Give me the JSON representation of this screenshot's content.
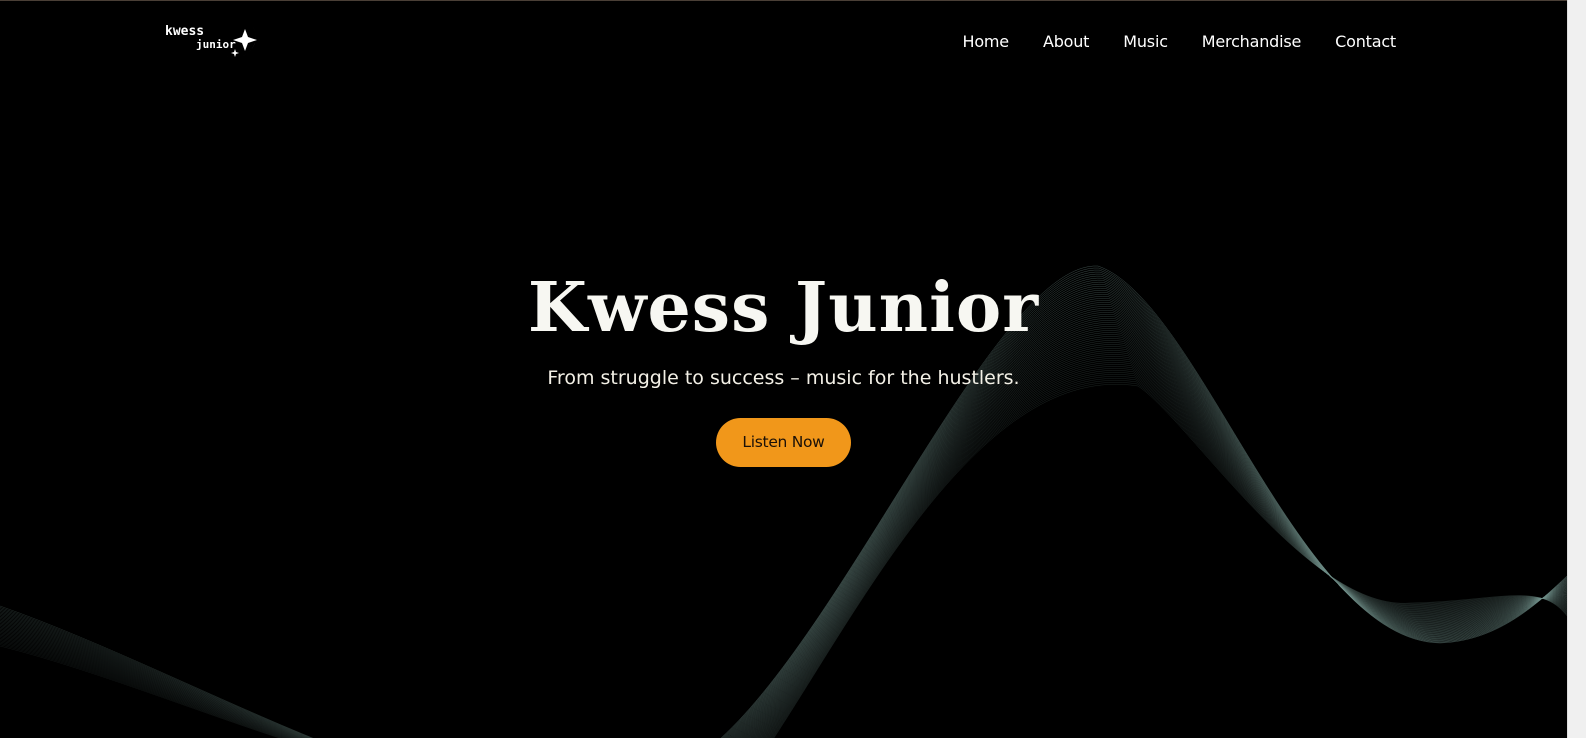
{
  "brand": {
    "logo_alt": "Kwess Junior",
    "logo_line1": "kwess",
    "logo_line2": "junior"
  },
  "nav": {
    "items": [
      {
        "label": "Home"
      },
      {
        "label": "About"
      },
      {
        "label": "Music"
      },
      {
        "label": "Merchandise"
      },
      {
        "label": "Contact"
      }
    ]
  },
  "hero": {
    "title": "Kwess Junior",
    "subtitle": "From struggle to success – music for the hustlers.",
    "cta_label": "Listen Now"
  },
  "colors": {
    "background": "#000000",
    "accent": "#f1971a",
    "text": "#ffffff",
    "wave_line": "#6f8e88"
  }
}
